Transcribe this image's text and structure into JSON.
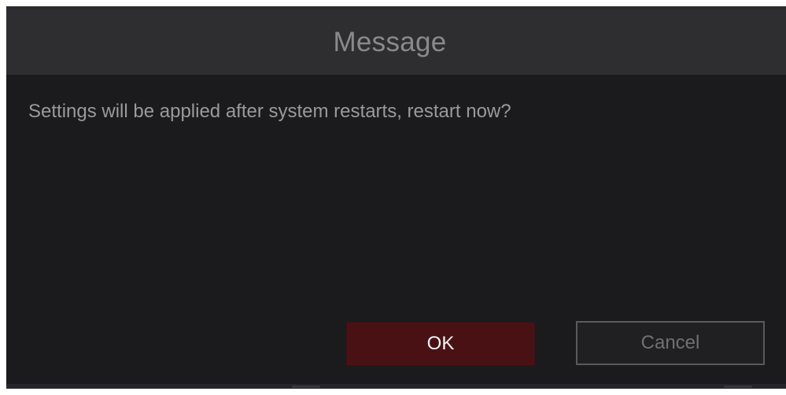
{
  "dialog": {
    "title": "Message",
    "message": "Settings will be applied after system restarts, restart now?",
    "ok_label": "OK",
    "cancel_label": "Cancel"
  },
  "colors": {
    "background": "#1b1b1e",
    "title_bar": "#2e2e30",
    "ok_button": "#4a1115",
    "cancel_border": "#5a5a5d"
  }
}
